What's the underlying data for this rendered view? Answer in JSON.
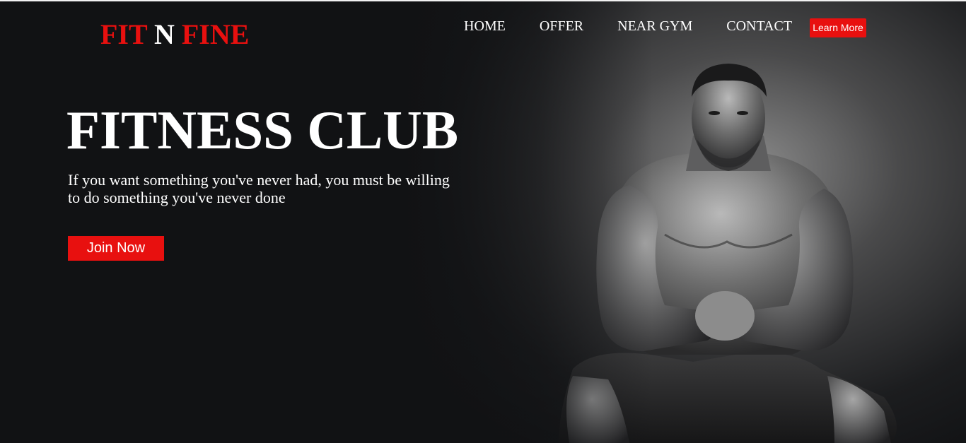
{
  "brand": {
    "part1": "FIT",
    "part2": "N",
    "part3": "FINE",
    "accent_color": "#e8100f"
  },
  "nav": {
    "items": [
      {
        "label": "HOME"
      },
      {
        "label": "OFFER"
      },
      {
        "label": "NEAR GYM"
      },
      {
        "label": "CONTACT"
      }
    ],
    "cta_label": "Learn More"
  },
  "hero": {
    "title": "FITNESS CLUB",
    "subtitle": "If you want something you've never had, you must be willing to do something you've never done",
    "button_label": "Join Now",
    "background_color": "#111214"
  },
  "icons": {
    "hero_image": "athlete-photo"
  }
}
